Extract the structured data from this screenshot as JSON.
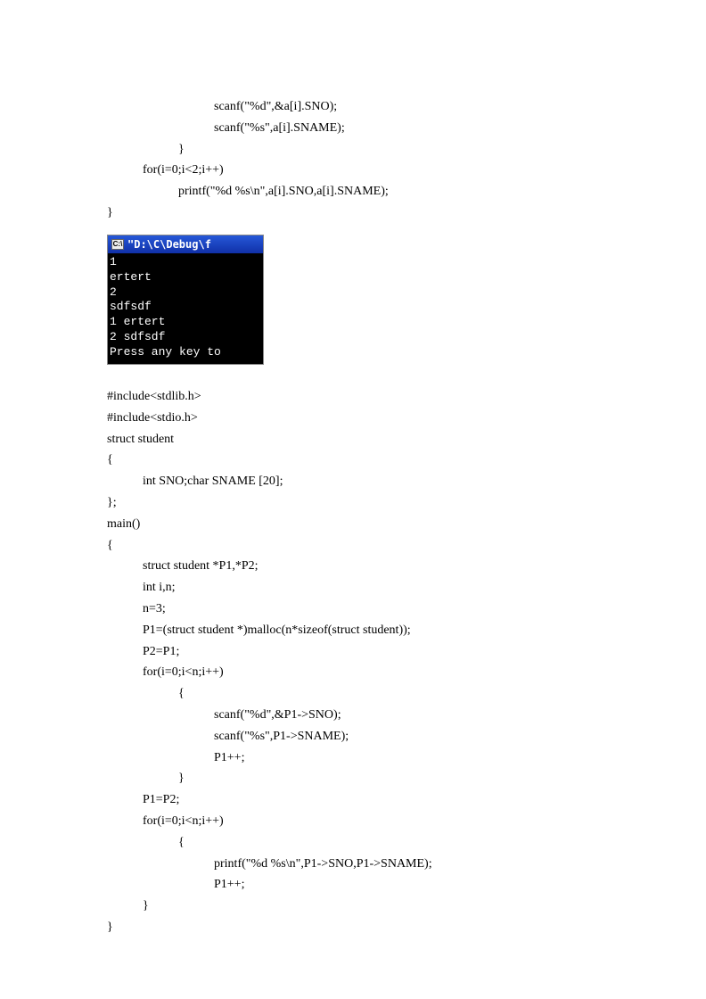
{
  "code1": {
    "l1": "scanf(\"%d\",&a[i].SNO);",
    "l2": "scanf(\"%s\",a[i].SNAME);",
    "l3": "}",
    "l4": "for(i=0;i<2;i++)",
    "l5": "printf(\"%d %s\\n\",a[i].SNO,a[i].SNAME);",
    "l6": "}"
  },
  "console": {
    "icon": "C:\\",
    "title": "\"D:\\C\\Debug\\f",
    "lines": "1\nertert\n2\nsdfsdf\n1 ertert\n2 sdfsdf\nPress any key to"
  },
  "code2": {
    "l1": "#include<stdlib.h>",
    "l2": "#include<stdio.h>",
    "l3": "struct student",
    "l4": "{",
    "l5": "int SNO;char SNAME [20];",
    "l6": "};",
    "l7": "main()",
    "l8": "{",
    "l9": "struct student *P1,*P2;",
    "l10": "int i,n;",
    "l11": "n=3;",
    "l12": "P1=(struct student *)malloc(n*sizeof(struct student));",
    "l13": "P2=P1;",
    "l14": "for(i=0;i<n;i++)",
    "l15": "{",
    "l16": "scanf(\"%d\",&P1->SNO);",
    "l17": "scanf(\"%s\",P1->SNAME);",
    "l18": "P1++;",
    "l19": "}",
    "l20": "P1=P2;",
    "l21": "for(i=0;i<n;i++)",
    "l22": "{",
    "l23": "printf(\"%d %s\\n\",P1->SNO,P1->SNAME);",
    "l24": "P1++;",
    "l25": "}",
    "l26": "}"
  }
}
